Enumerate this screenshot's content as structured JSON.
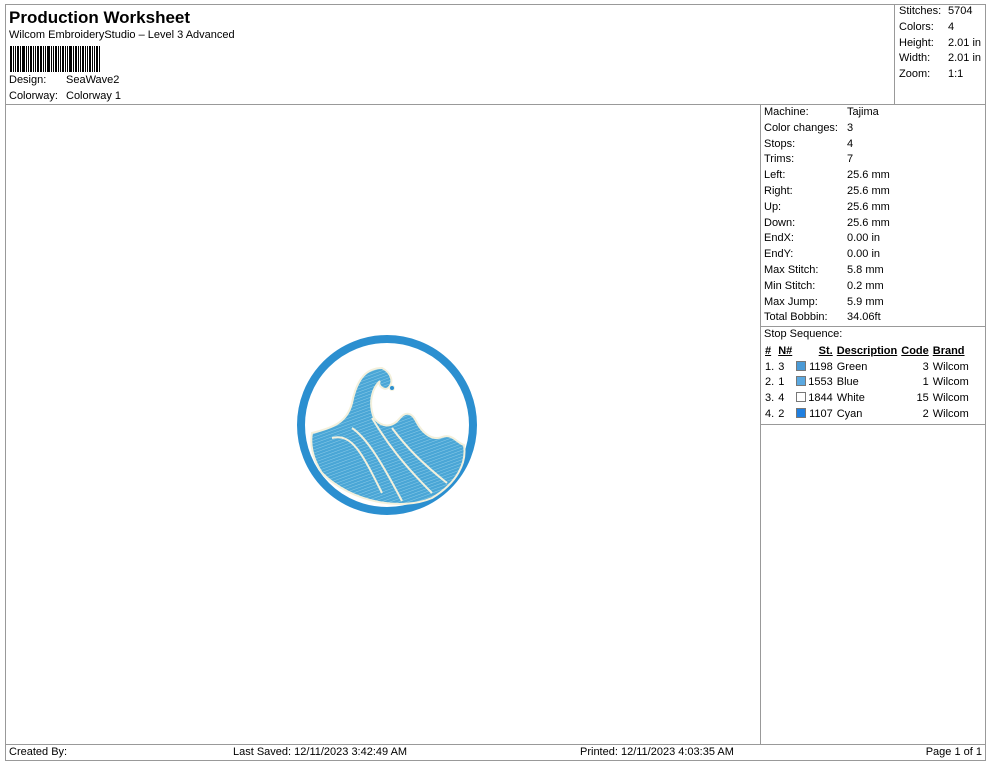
{
  "header": {
    "title": "Production Worksheet",
    "subtitle": "Wilcom EmbroideryStudio – Level 3 Advanced",
    "design_label": "Design:",
    "design_value": "SeaWave2",
    "colorway_label": "Colorway:",
    "colorway_value": "Colorway 1"
  },
  "stats": [
    {
      "k": "Stitches:",
      "v": "5704"
    },
    {
      "k": "Colors:",
      "v": "4"
    },
    {
      "k": "Height:",
      "v": "2.01 in"
    },
    {
      "k": "Width:",
      "v": "2.01 in"
    },
    {
      "k": "Zoom:",
      "v": "1:1"
    }
  ],
  "info": [
    {
      "k": "Machine:",
      "v": "Tajima"
    },
    {
      "k": "Color changes:",
      "v": "3"
    },
    {
      "k": "Stops:",
      "v": "4"
    },
    {
      "k": "Trims:",
      "v": "7"
    },
    {
      "k": "Left:",
      "v": "25.6 mm"
    },
    {
      "k": "Right:",
      "v": "25.6 mm"
    },
    {
      "k": "Up:",
      "v": "25.6 mm"
    },
    {
      "k": "Down:",
      "v": "25.6 mm"
    },
    {
      "k": "EndX:",
      "v": "0.00 in"
    },
    {
      "k": "EndY:",
      "v": "0.00 in"
    },
    {
      "k": "Max Stitch:",
      "v": "5.8 mm"
    },
    {
      "k": "Min Stitch:",
      "v": "0.2 mm"
    },
    {
      "k": "Max Jump:",
      "v": "5.9 mm"
    },
    {
      "k": "Total Bobbin:",
      "v": "34.06ft"
    }
  ],
  "stop_sequence": {
    "title": "Stop Sequence:",
    "headers": [
      "#",
      "N#",
      "St.",
      "Description",
      "Code",
      "Brand"
    ],
    "rows": [
      {
        "n": "1.",
        "nn": "3",
        "color": "#4a9ad6",
        "st": "1198",
        "desc": "Green",
        "code": "3",
        "brand": "Wilcom"
      },
      {
        "n": "2.",
        "nn": "1",
        "color": "#5aa8e0",
        "st": "1553",
        "desc": "Blue",
        "code": "1",
        "brand": "Wilcom"
      },
      {
        "n": "3.",
        "nn": "4",
        "color": "#ffffff",
        "st": "1844",
        "desc": "White",
        "code": "15",
        "brand": "Wilcom"
      },
      {
        "n": "4.",
        "nn": "2",
        "color": "#1f7fe0",
        "st": "1107",
        "desc": "Cyan",
        "code": "2",
        "brand": "Wilcom"
      }
    ]
  },
  "footer": {
    "created": "Created By:",
    "saved": "Last Saved: 12/11/2023 3:42:49 AM",
    "printed": "Printed: 12/11/2023 4:03:35 AM",
    "page": "Page 1 of 1"
  }
}
